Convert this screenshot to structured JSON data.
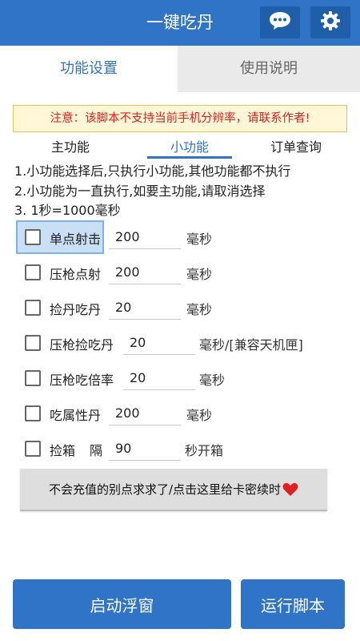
{
  "header": {
    "title": "一键吃丹",
    "chat_icon": "chat-bubble-icon",
    "settings_icon": "gear-icon"
  },
  "tabs": [
    {
      "label": "功能设置",
      "active": true
    },
    {
      "label": "使用说明",
      "active": false
    }
  ],
  "notice": "注意：该脚本不支持当前手机分辨率，请联系作者!",
  "subtabs": [
    {
      "label": "主功能"
    },
    {
      "label": "小功能",
      "active": true
    },
    {
      "label": "订单查询"
    }
  ],
  "info": [
    "1.小功能选择后,只执行小功能,其他功能都不执行",
    "2.小功能为一直执行,如要主功能,请取消选择",
    "3. 1秒=1000毫秒"
  ],
  "options": [
    {
      "label": "单点射击",
      "value": "200",
      "unit": "毫秒",
      "checked": false
    },
    {
      "label": "压枪点射",
      "value": "200",
      "unit": "毫秒",
      "checked": false
    },
    {
      "label": "捡丹吃丹",
      "value": "20",
      "unit": "毫秒",
      "checked": false
    },
    {
      "label": "压枪捡吃丹",
      "value": "20",
      "unit": "毫秒/[兼容天机匣]",
      "checked": false
    },
    {
      "label": "压枪吃倍率",
      "value": "20",
      "unit": "毫秒",
      "checked": false
    },
    {
      "label": "吃属性丹",
      "value": "200",
      "unit": "毫秒",
      "checked": false
    },
    {
      "label": "捡箱",
      "extra": "隔",
      "value": "90",
      "unit": "秒开箱",
      "checked": false
    }
  ],
  "card_button": {
    "label": "不会充值的别点求求了/点击这里给卡密续时",
    "icon": "heart-icon",
    "icon_color": "#e02020"
  },
  "footer": {
    "start_label": "启动浮窗",
    "run_label": "运行脚本"
  },
  "colors": {
    "primary": "#2f74c6",
    "notice_text": "#e02020"
  }
}
